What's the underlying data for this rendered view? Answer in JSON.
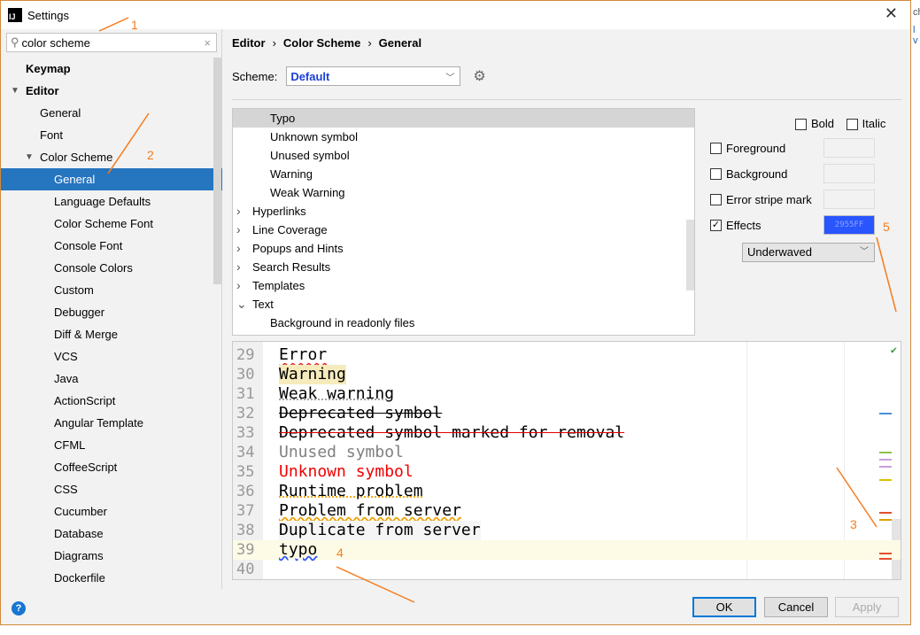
{
  "window": {
    "title": "Settings",
    "close": "✕"
  },
  "search": {
    "value": "color scheme",
    "clear": "×"
  },
  "sidebar": {
    "items": [
      {
        "label": "Keymap",
        "level": 0,
        "bold": true
      },
      {
        "label": "Editor",
        "level": 0,
        "bold": true,
        "expanded": true
      },
      {
        "label": "General",
        "level": 1
      },
      {
        "label": "Font",
        "level": 1
      },
      {
        "label": "Color Scheme",
        "level": 1,
        "expanded": true
      },
      {
        "label": "General",
        "level": 2,
        "selected": true
      },
      {
        "label": "Language Defaults",
        "level": 2
      },
      {
        "label": "Color Scheme Font",
        "level": 2
      },
      {
        "label": "Console Font",
        "level": 2
      },
      {
        "label": "Console Colors",
        "level": 2
      },
      {
        "label": "Custom",
        "level": 2
      },
      {
        "label": "Debugger",
        "level": 2
      },
      {
        "label": "Diff & Merge",
        "level": 2
      },
      {
        "label": "VCS",
        "level": 2
      },
      {
        "label": "Java",
        "level": 2
      },
      {
        "label": "ActionScript",
        "level": 2
      },
      {
        "label": "Angular Template",
        "level": 2
      },
      {
        "label": "CFML",
        "level": 2
      },
      {
        "label": "CoffeeScript",
        "level": 2
      },
      {
        "label": "CSS",
        "level": 2
      },
      {
        "label": "Cucumber",
        "level": 2
      },
      {
        "label": "Database",
        "level": 2
      },
      {
        "label": "Diagrams",
        "level": 2
      },
      {
        "label": "Dockerfile",
        "level": 2
      }
    ]
  },
  "breadcrumb": [
    "Editor",
    "Color Scheme",
    "General"
  ],
  "scheme": {
    "label": "Scheme:",
    "value": "Default"
  },
  "attributes": [
    {
      "label": "Typo",
      "level": 2,
      "selected": true
    },
    {
      "label": "Unknown symbol",
      "level": 2
    },
    {
      "label": "Unused symbol",
      "level": 2
    },
    {
      "label": "Warning",
      "level": 2
    },
    {
      "label": "Weak Warning",
      "level": 2
    },
    {
      "label": "Hyperlinks",
      "level": 1,
      "arrow": "right"
    },
    {
      "label": "Line Coverage",
      "level": 1,
      "arrow": "right"
    },
    {
      "label": "Popups and Hints",
      "level": 1,
      "arrow": "right"
    },
    {
      "label": "Search Results",
      "level": 1,
      "arrow": "right"
    },
    {
      "label": "Templates",
      "level": 1,
      "arrow": "right"
    },
    {
      "label": "Text",
      "level": 1,
      "arrow": "down"
    },
    {
      "label": "Background in readonly files",
      "level": 2
    }
  ],
  "props": {
    "bold": "Bold",
    "italic": "Italic",
    "foreground": "Foreground",
    "background": "Background",
    "error_stripe": "Error stripe mark",
    "effects": "Effects",
    "effects_checked": true,
    "effects_color": "2955FF",
    "effect_type": "Underwaved"
  },
  "preview": [
    {
      "num": "29",
      "text": "Error",
      "style": "error"
    },
    {
      "num": "30",
      "text": "Warning",
      "style": "warning"
    },
    {
      "num": "31",
      "text": "Weak warning",
      "style": "weak"
    },
    {
      "num": "32",
      "text": "Deprecated symbol",
      "style": "deprecated"
    },
    {
      "num": "33",
      "text": "Deprecated symbol marked for removal",
      "style": "removal"
    },
    {
      "num": "34",
      "text": "Unused symbol",
      "style": "unused"
    },
    {
      "num": "35",
      "text": "Unknown symbol",
      "style": "unknown"
    },
    {
      "num": "36",
      "text": "Runtime problem",
      "style": "runtime"
    },
    {
      "num": "37",
      "text": "Problem from server",
      "style": "server"
    },
    {
      "num": "38",
      "text": "Duplicate from server",
      "style": "duplicate"
    },
    {
      "num": "39",
      "text": "typo",
      "style": "typo",
      "current": true
    },
    {
      "num": "40",
      "text": "",
      "style": ""
    }
  ],
  "footer": {
    "help": "?",
    "ok": "OK",
    "cancel": "Cancel",
    "apply": "Apply"
  },
  "annotations": [
    "1",
    "2",
    "3",
    "4",
    "5"
  ],
  "colors": {
    "accent": "#2675bf",
    "effect": "#2955FF",
    "annotation": "#f57c1f"
  }
}
